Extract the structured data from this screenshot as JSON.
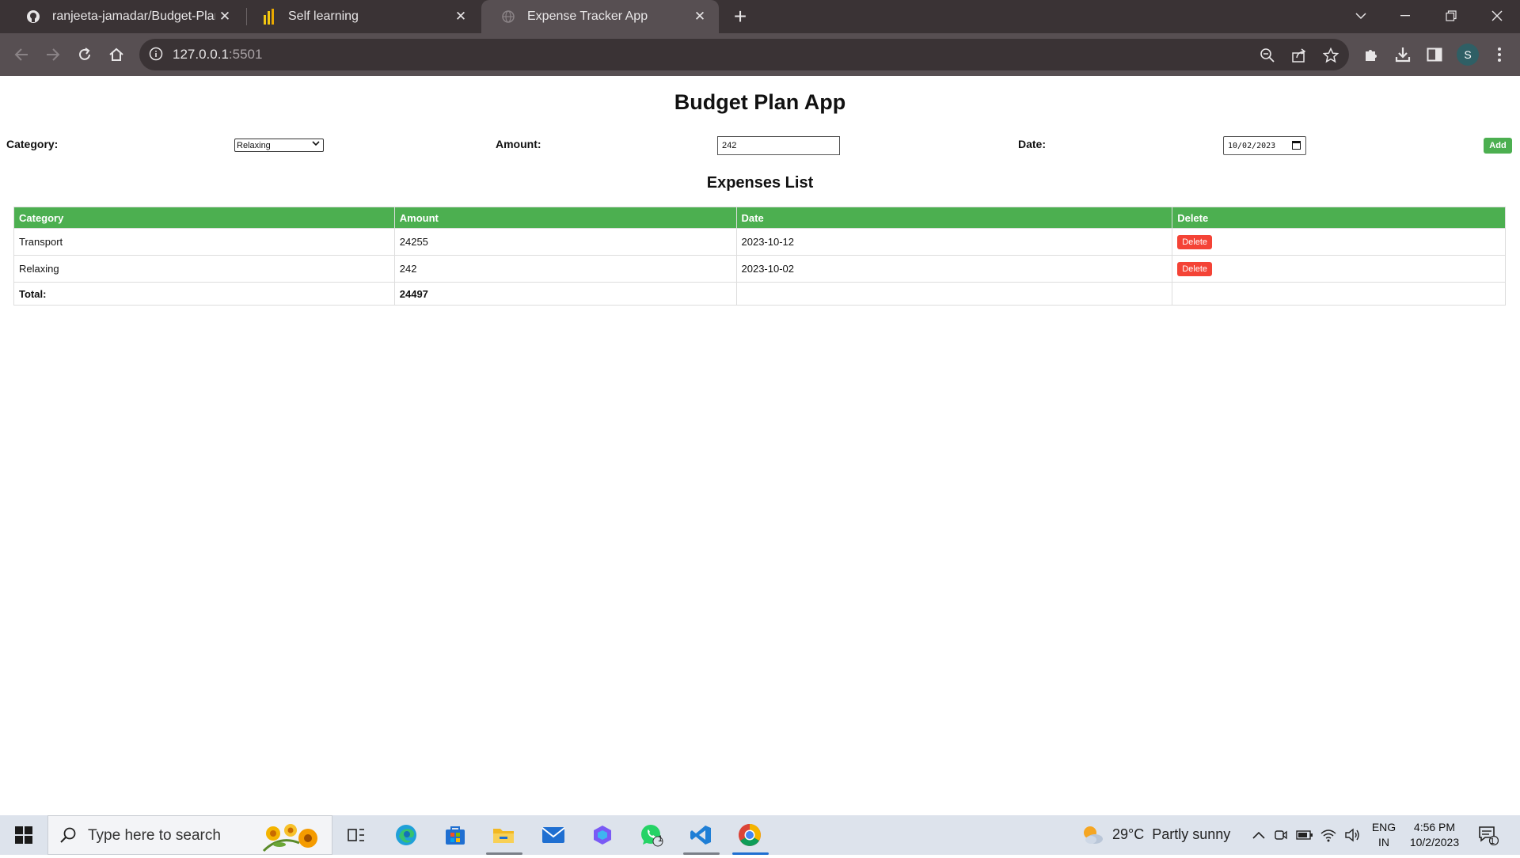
{
  "browser": {
    "tabs": [
      {
        "title": "ranjeeta-jamadar/Budget-Plan",
        "icon": "github-icon",
        "active": false
      },
      {
        "title": "Self learning",
        "icon": "power-bi-icon",
        "active": false
      },
      {
        "title": "Expense Tracker App",
        "icon": "globe-icon",
        "active": true
      }
    ],
    "url_host": "127.0.0.1",
    "url_port": ":5501",
    "avatar_letter": "S"
  },
  "app": {
    "title": "Budget Plan App",
    "form": {
      "category_label": "Category:",
      "category_value": "Relaxing",
      "amount_label": "Amount:",
      "amount_value": "242",
      "date_label": "Date:",
      "date_value": "10/02/2023",
      "add_label": "Add"
    },
    "list_title": "Expenses List",
    "table": {
      "headers": [
        "Category",
        "Amount",
        "Date",
        "Delete"
      ],
      "rows": [
        {
          "category": "Transport",
          "amount": "24255",
          "date": "2023-10-12",
          "delete_label": "Delete"
        },
        {
          "category": "Relaxing",
          "amount": "242",
          "date": "2023-10-02",
          "delete_label": "Delete"
        }
      ],
      "total_label": "Total:",
      "total_value": "24497"
    },
    "colors": {
      "header_green": "#4caf50",
      "delete_red": "#f44336"
    }
  },
  "taskbar": {
    "search_placeholder": "Type here to search",
    "whatsapp_badge": "1",
    "weather_temp": "29°C",
    "weather_desc": "Partly sunny",
    "lang_top": "ENG",
    "lang_bottom": "IN",
    "time": "4:56 PM",
    "date": "10/2/2023",
    "notification_count": "1"
  }
}
